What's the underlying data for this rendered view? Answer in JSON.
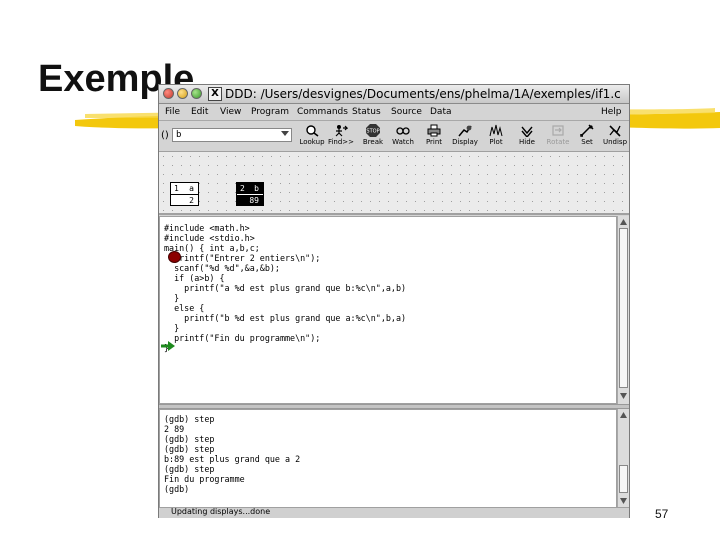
{
  "slide": {
    "title": "Exemple",
    "page_number": "57",
    "colors": {
      "brush": "#f2c500"
    }
  },
  "window": {
    "title": "DDD: /Users/desvignes/Documents/ens/phelma/1A/exemples/if1.c",
    "close_glyph": "X"
  },
  "menu": {
    "items": [
      "File",
      "Edit",
      "View",
      "Program",
      "Commands",
      "Status",
      "Source",
      "Data"
    ],
    "help": "Help"
  },
  "toolbar": {
    "arg_label": "()",
    "arg_value": "b",
    "tools": [
      {
        "label": "Lookup",
        "icon": "lookup-icon",
        "enabled": true
      },
      {
        "label": "Find>>",
        "icon": "find-icon",
        "enabled": true
      },
      {
        "label": "Break",
        "icon": "stop-sign-icon",
        "enabled": true
      },
      {
        "label": "Watch",
        "icon": "glasses-icon",
        "enabled": true
      },
      {
        "label": "Print",
        "icon": "print-icon",
        "enabled": true
      },
      {
        "label": "Display",
        "icon": "display-icon",
        "enabled": true
      },
      {
        "label": "Plot",
        "icon": "plot-icon",
        "enabled": true
      },
      {
        "label": "Hide",
        "icon": "hide-icon",
        "enabled": true
      },
      {
        "label": "Rotate",
        "icon": "rotate-icon",
        "enabled": false
      },
      {
        "label": "Set",
        "icon": "set-icon",
        "enabled": true
      },
      {
        "label": "Undisp",
        "icon": "undisplay-icon",
        "enabled": true
      }
    ]
  },
  "data_displays": [
    {
      "number": "1",
      "name": "a",
      "value": "2"
    },
    {
      "number": "2",
      "name": "b",
      "value": "89"
    }
  ],
  "source": {
    "lines": [
      "#include <math.h>",
      "#include <stdio.h>",
      "main() { int a,b,c;",
      "  printf(\"Entrer 2 entiers\\n\");",
      "  scanf(\"%d %d\",&a,&b);",
      "  if (a>b) {",
      "    printf(\"a %d est plus grand que b:%c\\n\",a,b)",
      "  }",
      "  else {",
      "    printf(\"b %d est plus grand que a:%c\\n\",b,a)",
      "  }",
      "  printf(\"Fin du programme\\n\");",
      "}"
    ],
    "breakpoint_line": 4,
    "exec_line": 13
  },
  "console": {
    "lines": [
      "(gdb) step",
      "2 89",
      "(gdb) step",
      "(gdb) step",
      "b:89 est plus grand que a 2",
      "(gdb) step",
      "Fin du programme",
      "(gdb)"
    ]
  },
  "status": {
    "text": "Updating displays...done"
  }
}
